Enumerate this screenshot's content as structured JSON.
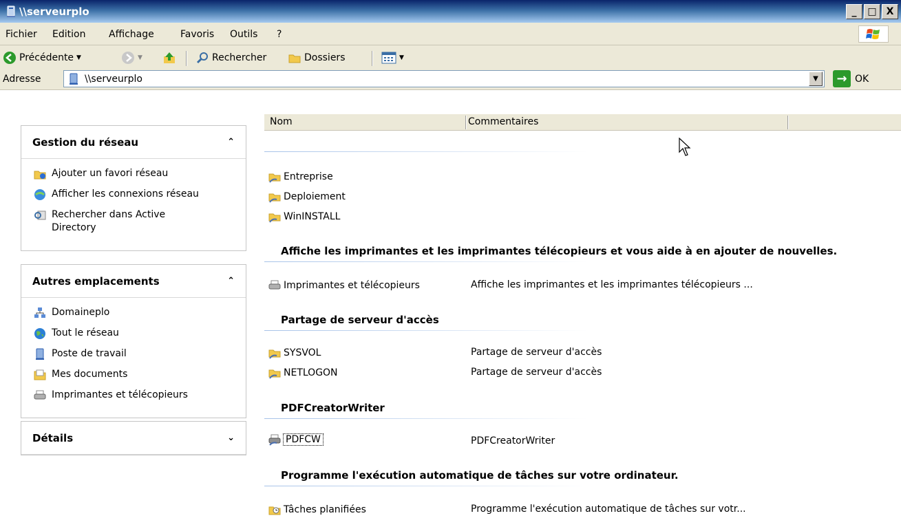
{
  "window": {
    "title": "\\\\serveurplo",
    "min": "_",
    "max": "□",
    "close": "X"
  },
  "menu": {
    "items": [
      "Fichier",
      "Edition",
      "Affichage",
      "Favoris",
      "Outils",
      "?"
    ]
  },
  "toolbar": {
    "back": "Précédente",
    "search": "Rechercher",
    "folders": "Dossiers"
  },
  "address": {
    "label": "Adresse",
    "value": "\\\\serveurplo",
    "go": "OK"
  },
  "tasks": {
    "network": {
      "title": "Gestion du réseau",
      "items": [
        "Ajouter un favori réseau",
        "Afficher les connexions réseau",
        "Rechercher dans Active Directory"
      ]
    },
    "other": {
      "title": "Autres emplacements",
      "items": [
        "Domaineplo",
        "Tout le réseau",
        "Poste de travail",
        "Mes documents",
        "Imprimantes et télécopieurs"
      ]
    },
    "details": {
      "title": "Détails"
    }
  },
  "columns": {
    "name": "Nom",
    "comments": "Commentaires"
  },
  "shares": [
    "Entreprise",
    "Deploiement",
    "WinINSTALL"
  ],
  "groups": {
    "printers": {
      "title": "Affiche les imprimantes et les imprimantes télécopieurs et vous aide à en ajouter de nouvelles.",
      "item": "Imprimantes et télécopieurs",
      "comment": "Affiche les imprimantes et les imprimantes télécopieurs ..."
    },
    "access": {
      "title": "Partage de serveur d'accès",
      "items": [
        {
          "name": "SYSVOL",
          "comment": "Partage de serveur d'accès"
        },
        {
          "name": "NETLOGON",
          "comment": "Partage de serveur d'accès"
        }
      ]
    },
    "pdf": {
      "title": "PDFCreatorWriter",
      "item": "PDFCW",
      "comment": "PDFCreatorWriter"
    },
    "tasks": {
      "title": "Programme l'exécution automatique de tâches sur votre ordinateur.",
      "item": "Tâches planifiées",
      "comment": "Programme l'exécution automatique de tâches sur votr..."
    }
  },
  "colors": {
    "titlebar": "#0a246a",
    "chrome": "#ece9d8",
    "accent": "#a6c2e8"
  }
}
